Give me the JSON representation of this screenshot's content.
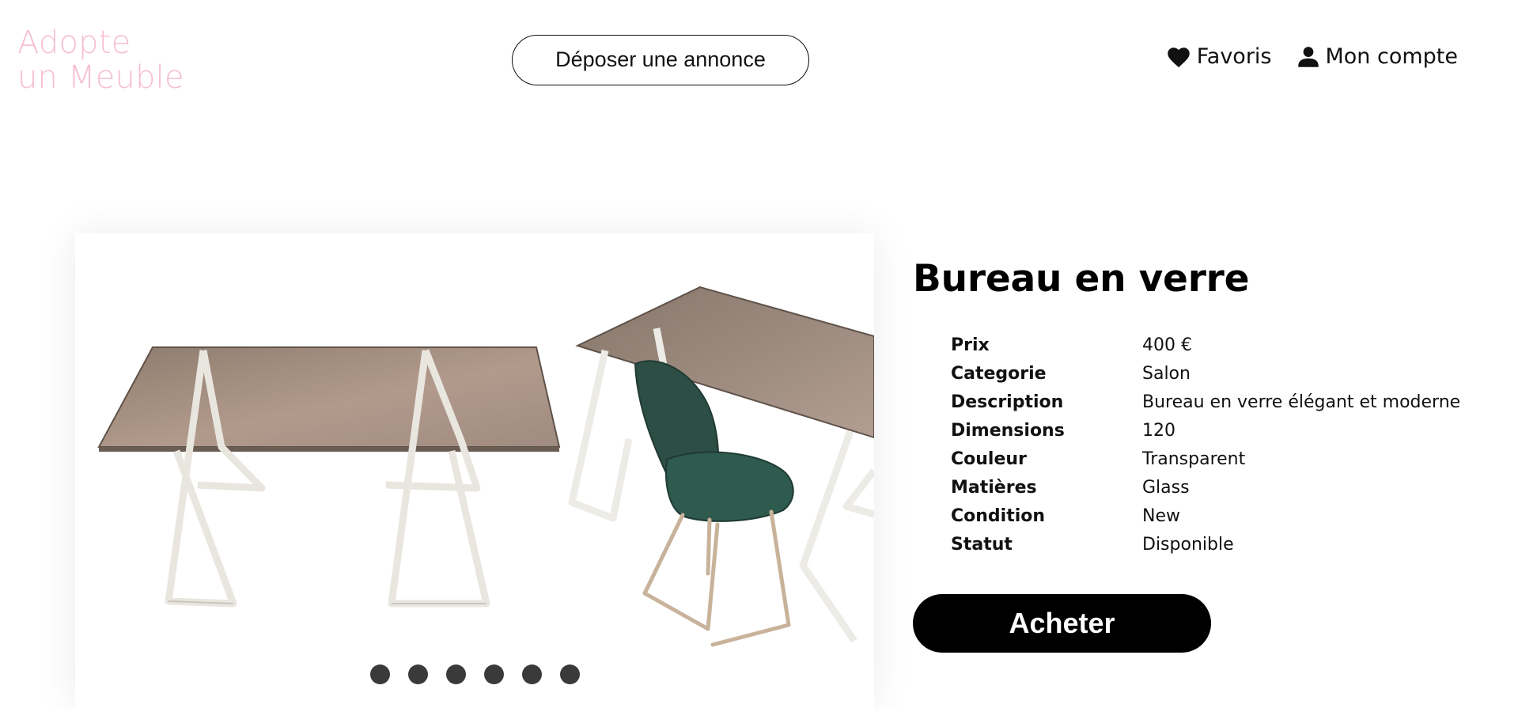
{
  "header": {
    "logo_line1": "Adopte",
    "logo_line2": "un Meuble",
    "post_ad_label": "Déposer une annonce",
    "nav": {
      "favorites_label": "Favoris",
      "favorites_icon": "heart-icon",
      "account_label": "Mon compte",
      "account_icon": "user-icon"
    }
  },
  "product": {
    "title": "Bureau en verre",
    "details": [
      {
        "key": "Prix",
        "value": "400 €"
      },
      {
        "key": "Categorie",
        "value": "Salon"
      },
      {
        "key": "Description",
        "value": "Bureau en verre élégant et moderne"
      },
      {
        "key": "Dimensions",
        "value": "120"
      },
      {
        "key": "Couleur",
        "value": "Transparent"
      },
      {
        "key": "Matières",
        "value": "Glass"
      },
      {
        "key": "Condition",
        "value": "New"
      },
      {
        "key": "Statut",
        "value": "Disponible"
      }
    ],
    "buy_label": "Acheter"
  },
  "gallery": {
    "slide_count": 6
  },
  "colors": {
    "logo": "#f7bfd0",
    "button_dark": "#000000",
    "dot": "#3a3a3a"
  }
}
